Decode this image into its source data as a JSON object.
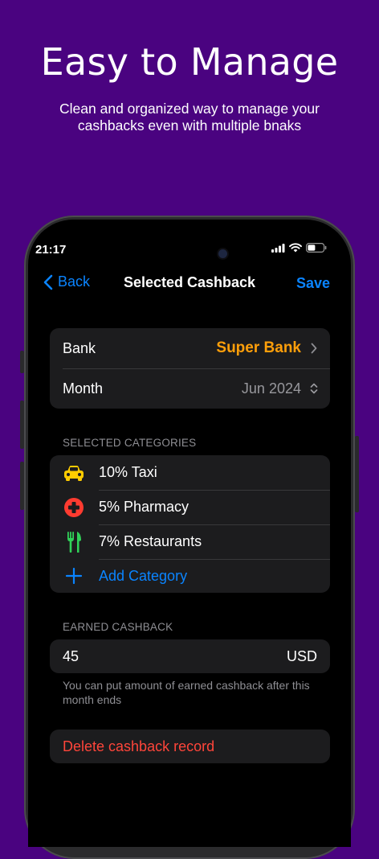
{
  "promo": {
    "title": "Easy to Manage",
    "subtitle": "Clean and organized way to manage your\ncashbacks  even with multiple bnaks"
  },
  "status_bar": {
    "time": "21:17"
  },
  "nav": {
    "back_label": "Back",
    "title": "Selected Cashback",
    "save_label": "Save"
  },
  "details": {
    "bank_label": "Bank",
    "bank_value": "Super Bank",
    "month_label": "Month",
    "month_value": "Jun 2024"
  },
  "categories": {
    "header": "SELECTED CATEGORIES",
    "items": [
      {
        "label": "10% Taxi",
        "icon": "taxi-icon",
        "color": "#ffcc00"
      },
      {
        "label": "5% Pharmacy",
        "icon": "pharmacy-icon",
        "color": "#ff3b30"
      },
      {
        "label": "7% Restaurants",
        "icon": "fork-knife-icon",
        "color": "#30d158"
      }
    ],
    "add_label": "Add Category"
  },
  "earned": {
    "header": "EARNED CASHBACK",
    "amount": "45",
    "currency": "USD",
    "note": "You can put amount of earned cashback after this month ends"
  },
  "delete_label": "Delete cashback record",
  "colors": {
    "background": "#4a0380",
    "accent_blue": "#0a84ff",
    "accent_orange": "#ff9f0a",
    "destructive": "#ff453a",
    "card": "#1c1c1e"
  }
}
